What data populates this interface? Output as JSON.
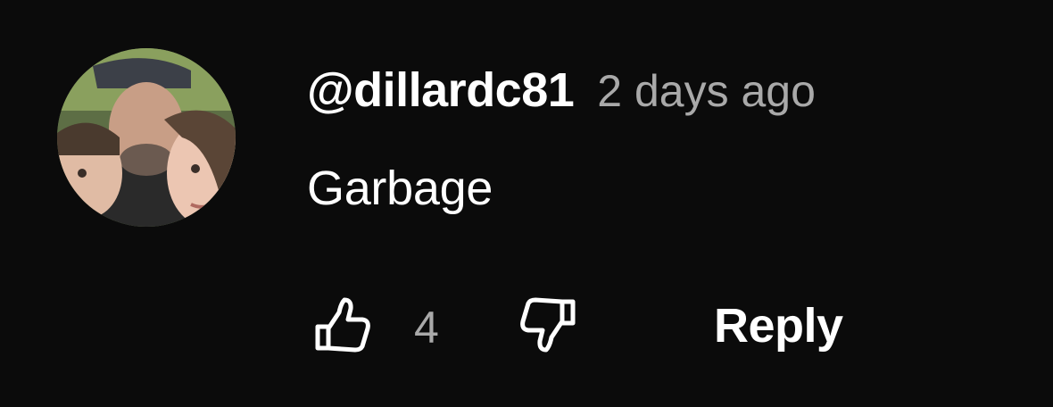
{
  "comment": {
    "author": {
      "handle": "@dillardc81",
      "avatar": "avatar-photo"
    },
    "timestamp": "2 days ago",
    "text": "Garbage",
    "actions": {
      "like_icon": "thumbs-up-icon",
      "like_count": "4",
      "dislike_icon": "thumbs-down-icon",
      "reply_label": "Reply"
    }
  },
  "colors": {
    "background": "#0b0b0b",
    "primary_text": "#ffffff",
    "secondary_text": "#a9a9a9"
  }
}
